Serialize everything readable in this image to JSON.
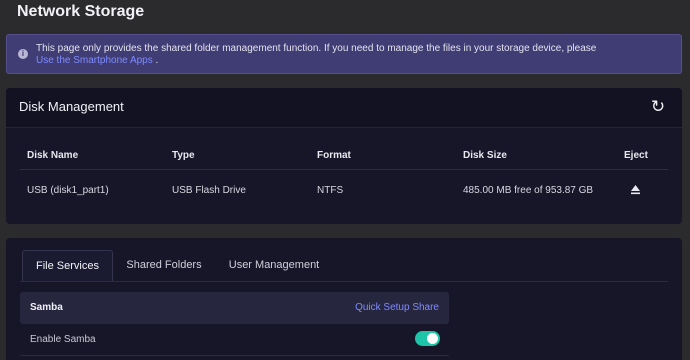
{
  "page": {
    "title": "Network Storage"
  },
  "notice": {
    "icon": "info-icon",
    "text": "This page only provides the shared folder management function. If you need to manage the files in your storage device, please",
    "link": "Use the Smartphone Apps",
    "suffix": " ."
  },
  "disk_management": {
    "title": "Disk Management",
    "refresh_icon": "refresh-icon",
    "columns": [
      "Disk Name",
      "Type",
      "Format",
      "Disk Size",
      "Eject"
    ],
    "rows": [
      {
        "disk_name": "USB (disk1_part1)",
        "type": "USB Flash Drive",
        "format": "NTFS",
        "disk_size": "485.00 MB free of 953.87 GB",
        "eject_icon": "eject-icon"
      }
    ]
  },
  "tabs": [
    {
      "label": "File Services",
      "active": true
    },
    {
      "label": "Shared Folders",
      "active": false
    },
    {
      "label": "User Management",
      "active": false
    }
  ],
  "samba": {
    "title": "Samba",
    "quick_setup": "Quick Setup Share",
    "enable_label": "Enable Samba",
    "enabled": true
  },
  "colors": {
    "background": "#2b2b2e",
    "card": "#161628",
    "notice": "#403c74",
    "link": "#7d8cff",
    "toggle_on": "#1ec4a8"
  }
}
